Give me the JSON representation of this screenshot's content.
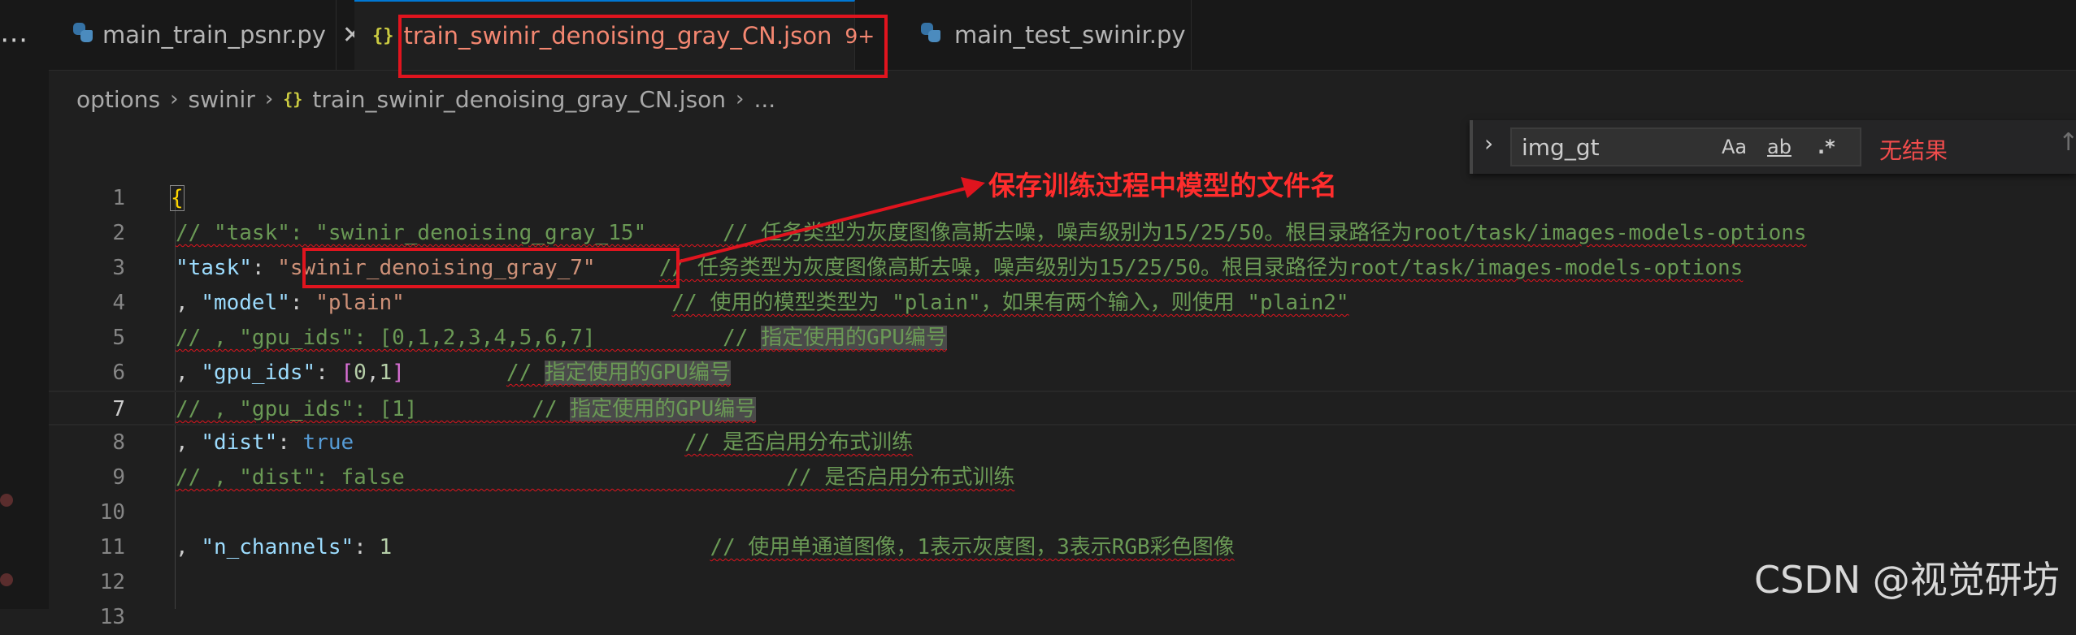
{
  "tabs": [
    {
      "label": "main_train_psnr.py",
      "close": "✕"
    },
    {
      "label": "train_swinir_denoising_gray_CN.json",
      "badge": "9+",
      "close": "✕"
    },
    {
      "label": "main_test_swinir.py"
    }
  ],
  "breadcrumb": {
    "folder1": "options",
    "folder2": "swinir",
    "file": "train_swinir_denoising_gray_CN.json",
    "ellipsis": "..."
  },
  "find": {
    "value": "img_gt",
    "match_case": "Aa",
    "whole_word": "ab",
    "regex": ".*",
    "result": "无结果"
  },
  "editor": {
    "current_line": 7,
    "line_numbers": [
      "1",
      "2",
      "3",
      "4",
      "5",
      "6",
      "7",
      "8",
      "9",
      "10",
      "11",
      "12",
      "13"
    ]
  },
  "annotation": "保存训练过程中模型的文件名",
  "watermark": "CSDN @视觉研坊",
  "colors": {
    "accent_red": "#e0141e",
    "error_text": "#f14c4c",
    "comment": "#6a9955",
    "string": "#ce9178",
    "key": "#9cdcfe"
  }
}
